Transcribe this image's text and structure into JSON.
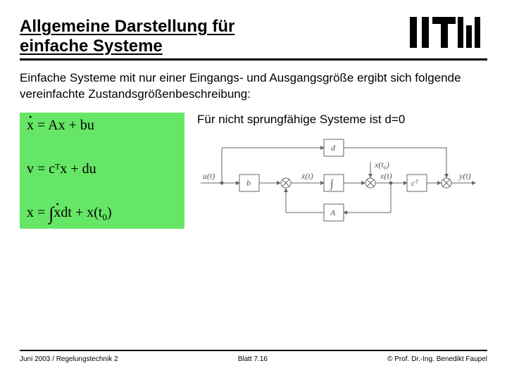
{
  "header": {
    "title_line1": "Allgemeine Darstellung für",
    "title_line2": "einfache Systeme",
    "logo_text": "HTW"
  },
  "intro": "Einfache Systeme mit nur einer Eingangs- und Ausgangsgröße ergibt sich folgende vereinfachte Zustandsgrößenbeschreibung:",
  "equations": {
    "eq1_lhs_var": "x",
    "eq1_rhs": " = Ax + bu",
    "eq2": "v = cᵀx + du",
    "eq3_prefix": "x = ",
    "eq3_var": "x",
    "eq3_suffix_a": "dt + x(t",
    "eq3_sub": "0",
    "eq3_suffix_b": ")"
  },
  "right": {
    "sprung_text": "Für nicht sprungfähige Systeme ist d=0"
  },
  "diagram": {
    "u_label": "u(t)",
    "b_label": "b",
    "xdot_label": "ẋ(t)",
    "int_label": "∫",
    "x_label": "x(t)",
    "x0_label": "x(t₀)",
    "cT_label": "cᵀ",
    "y_label": "y(t)",
    "A_label": "A",
    "d_label": "d"
  },
  "footer": {
    "left": "Juni 2003 / Regelungstechnik 2",
    "center": "Blatt 7.16",
    "right": "© Prof. Dr.-Ing. Benedikt Faupel"
  }
}
